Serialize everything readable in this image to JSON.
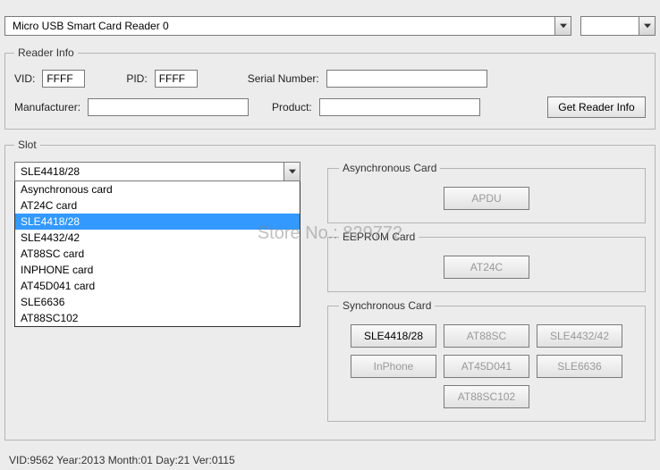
{
  "top": {
    "reader_name": "Micro USB Smart Card Reader 0"
  },
  "reader_info": {
    "legend": "Reader Info",
    "vid_label": "VID:",
    "vid_value": "FFFF",
    "pid_label": "PID:",
    "pid_value": "FFFF",
    "serial_label": "Serial Number:",
    "serial_value": "",
    "manufacturer_label": "Manufacturer:",
    "manufacturer_value": "",
    "product_label": "Product:",
    "product_value": "",
    "get_info_btn": "Get Reader Info"
  },
  "slot": {
    "legend": "Slot",
    "selected": "SLE4418/28",
    "options": [
      "Asynchronous card",
      "AT24C card",
      "SLE4418/28",
      "SLE4432/42",
      "AT88SC card",
      "INPHONE card",
      "AT45D041 card",
      "SLE6636",
      "AT88SC102"
    ],
    "async": {
      "legend": "Asynchronous Card",
      "apdu_btn": "APDU"
    },
    "eeprom": {
      "legend": "EEPROM Card",
      "at24c_btn": "AT24C"
    },
    "sync": {
      "legend": "Synchronous Card",
      "buttons": [
        {
          "label": "SLE4418/28",
          "enabled": true
        },
        {
          "label": "AT88SC",
          "enabled": false
        },
        {
          "label": "SLE4432/42",
          "enabled": false
        },
        {
          "label": "InPhone",
          "enabled": false
        },
        {
          "label": "AT45D041",
          "enabled": false
        },
        {
          "label": "SLE6636",
          "enabled": false
        },
        {
          "label": "AT88SC102",
          "enabled": false
        }
      ]
    }
  },
  "status": "VID:9562 Year:2013 Month:01 Day:21 Ver:0115",
  "watermark": "Store No.: 829772"
}
